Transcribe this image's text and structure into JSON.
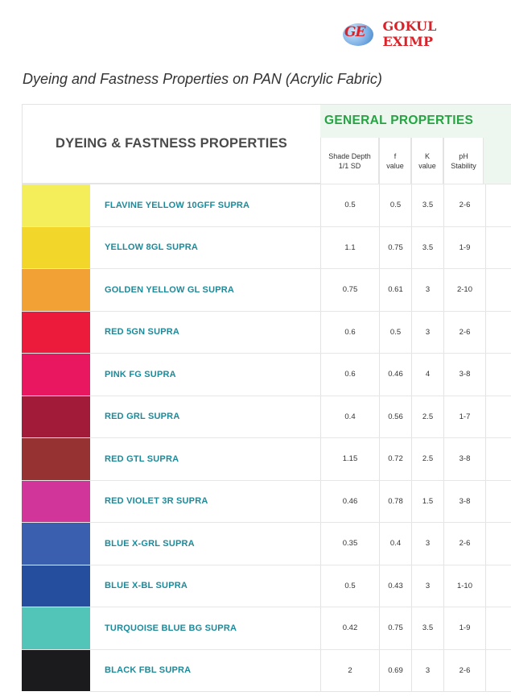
{
  "brand": {
    "logo_mark": "GE",
    "name": "GOKUL EXIMP"
  },
  "page_title": "Dyeing and Fastness Properties on PAN (Acrylic Fabric)",
  "table": {
    "left_header": "DYEING & FASTNESS PROPERTIES",
    "group_header": "GENERAL PROPERTIES",
    "columns": [
      {
        "line1": "Shade Depth",
        "line2": "1/1 SD"
      },
      {
        "line1": "f",
        "line2": "value"
      },
      {
        "line1": "K",
        "line2": "value"
      },
      {
        "line1": "pH",
        "line2": "Stability"
      }
    ],
    "rows": [
      {
        "name": "FLAVINE YELLOW 10GFF SUPRA",
        "color": "#f5ee5b",
        "shade_depth": "0.5",
        "f": "0.5",
        "k": "3.5",
        "ph": "2-6"
      },
      {
        "name": "YELLOW 8GL SUPRA",
        "color": "#f2d629",
        "shade_depth": "1.1",
        "f": "0.75",
        "k": "3.5",
        "ph": "1-9"
      },
      {
        "name": "GOLDEN YELLOW GL SUPRA",
        "color": "#f2a134",
        "shade_depth": "0.75",
        "f": "0.61",
        "k": "3",
        "ph": "2-10"
      },
      {
        "name": "RED 5GN SUPRA",
        "color": "#ec1b3c",
        "shade_depth": "0.6",
        "f": "0.5",
        "k": "3",
        "ph": "2-6"
      },
      {
        "name": "PINK FG SUPRA",
        "color": "#e9175f",
        "shade_depth": "0.6",
        "f": "0.46",
        "k": "4",
        "ph": "3-8"
      },
      {
        "name": "RED GRL SUPRA",
        "color": "#a21b39",
        "shade_depth": "0.4",
        "f": "0.56",
        "k": "2.5",
        "ph": "1-7"
      },
      {
        "name": "RED GTL SUPRA",
        "color": "#963231",
        "shade_depth": "1.15",
        "f": "0.72",
        "k": "2.5",
        "ph": "3-8"
      },
      {
        "name": "RED VIOLET 3R SUPRA",
        "color": "#d1359a",
        "shade_depth": "0.46",
        "f": "0.78",
        "k": "1.5",
        "ph": "3-8"
      },
      {
        "name": "BLUE X-GRL SUPRA",
        "color": "#3a5fae",
        "shade_depth": "0.35",
        "f": "0.4",
        "k": "3",
        "ph": "2-6"
      },
      {
        "name": "BLUE X-BL SUPRA",
        "color": "#254e9f",
        "shade_depth": "0.5",
        "f": "0.43",
        "k": "3",
        "ph": "1-10"
      },
      {
        "name": "TURQUOISE BLUE BG SUPRA",
        "color": "#52c4b8",
        "shade_depth": "0.42",
        "f": "0.75",
        "k": "3.5",
        "ph": "1-9"
      },
      {
        "name": "BLACK FBL SUPRA",
        "color": "#1b1b1e",
        "shade_depth": "2",
        "f": "0.69",
        "k": "3",
        "ph": "2-6"
      }
    ]
  }
}
